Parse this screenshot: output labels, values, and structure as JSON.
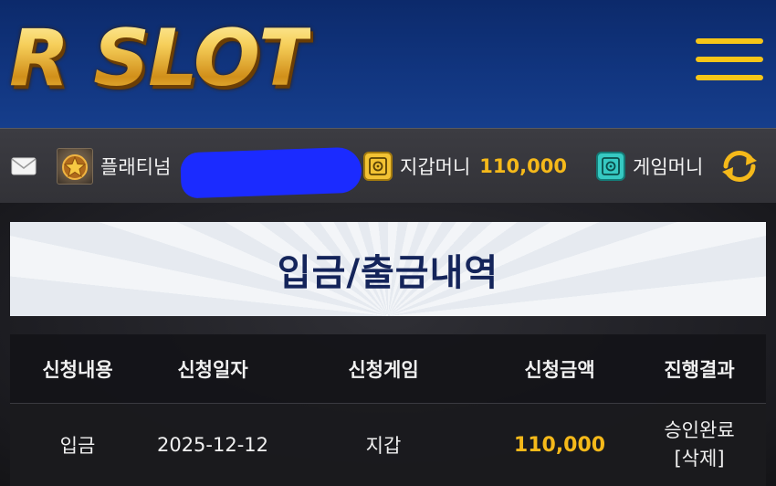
{
  "header": {
    "logo_text": "R SLOT",
    "menu_icon": "hamburger-icon"
  },
  "infobar": {
    "mail_icon": "envelope-icon",
    "grade_label": "플래티넘",
    "wallet_label": "지갑머니",
    "wallet_value": "110,000",
    "game_label": "게임머니",
    "refresh_icon": "refresh-icon"
  },
  "page": {
    "title": "입금/출금내역"
  },
  "table": {
    "headers": [
      "신청내용",
      "신청일자",
      "신청게임",
      "신청금액",
      "진행결과"
    ],
    "rows": [
      {
        "type": "입금",
        "date": "2025-12-12",
        "game": "지갑",
        "amount": "110,000",
        "status": "승인완료",
        "action": "[삭제]"
      }
    ]
  },
  "colors": {
    "header_bg": "#11357f",
    "accent_gold": "#f5b91a",
    "menu_yellow": "#f5c518",
    "title_navy": "#14245a"
  }
}
